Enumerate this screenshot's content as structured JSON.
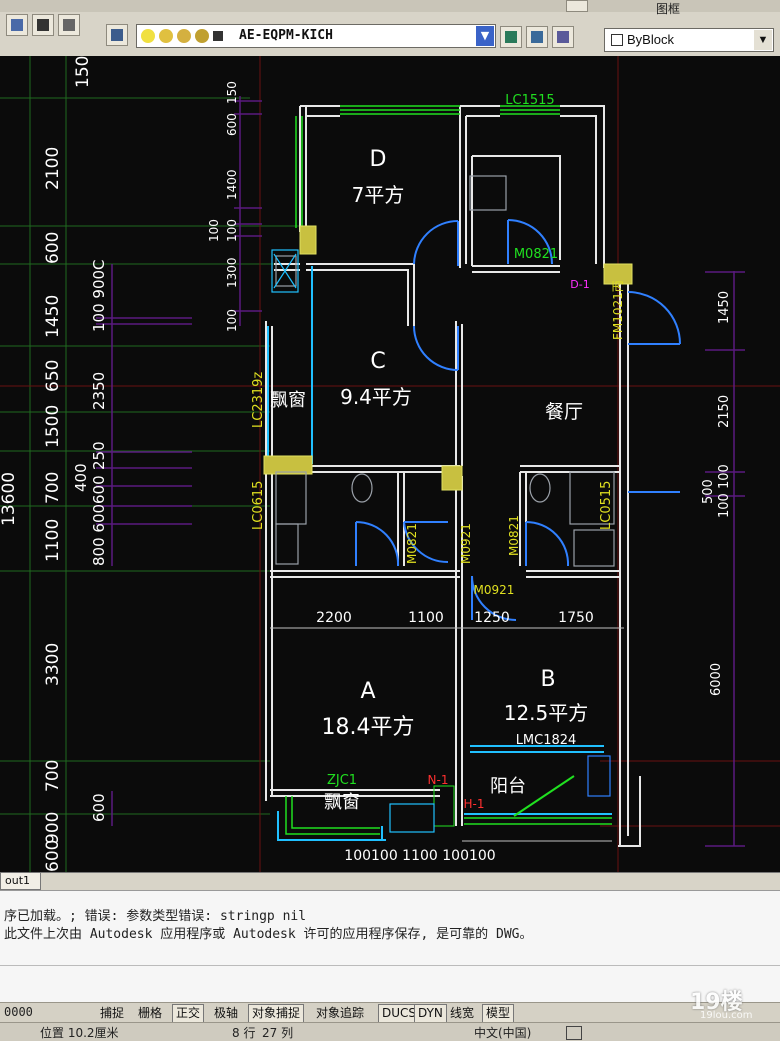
{
  "toolbar": {
    "top_label": "图框",
    "layer_name": "AE-EQPM-KICH",
    "linetype": "ByBlock"
  },
  "drawing": {
    "rooms": [
      {
        "name": "D",
        "area": "7平方"
      },
      {
        "name": "C",
        "area": "9.4平方"
      },
      {
        "name": "餐厅"
      },
      {
        "name": "A",
        "area": "18.4平方"
      },
      {
        "name": "B",
        "area": "12.5平方"
      }
    ],
    "labels": {
      "lc1515": "LC1515",
      "m0821_top": "M0821",
      "d1": "D-1",
      "fm1021": "FM1021丙",
      "piaochuang1": "飘窗",
      "lc2319z": "LC2319z",
      "lc0615": "LC0615",
      "lc0515": "LC0515",
      "m0821_a": "M0821",
      "m0921_a": "M0921",
      "m0821_b": "M0821",
      "m0921_b": "M0921",
      "n1": "N-1",
      "h1": "H-1",
      "zjc1": "ZJC1",
      "piaochuang2": "飘窗",
      "lmc1824": "LMC1824",
      "balcony": "阳台"
    },
    "dims_left_outer": [
      "150",
      "2100",
      "600",
      "1450",
      "650",
      "1500",
      "700",
      "1100",
      "3300",
      "700",
      "900",
      "600",
      "13600"
    ],
    "dims_left_mid": [
      "100 900C",
      "2350",
      "250",
      "400",
      "600",
      "800 600",
      "600"
    ],
    "dims_window": [
      "150",
      "600",
      "1400",
      "100",
      "100",
      "1300",
      "100"
    ],
    "dims_horizontal": [
      "2200",
      "1100",
      "1250",
      "1750"
    ],
    "dims_bottom": "100100 1100 100100",
    "dims_right": [
      "1450",
      "2150",
      "500",
      "100 100",
      "6000"
    ]
  },
  "tab": {
    "label": "out1"
  },
  "command": {
    "line1": "序已加载。; 错误: 参数类型错误: stringp nil",
    "line2": "此文件上次由 Autodesk 应用程序或 Autodesk 许可的应用程序保存, 是可靠的 DWG。"
  },
  "status": {
    "coords": "0000",
    "buttons": [
      "捕捉",
      "栅格",
      "正交",
      "极轴",
      "对象捕捉",
      "对象追踪",
      "DUCS",
      "DYN",
      "线宽",
      "模型"
    ]
  },
  "bottom": {
    "position": "位置 10.2厘米",
    "row": "8 行",
    "col": "27 列",
    "ime": "中文(中国)"
  },
  "watermark": {
    "text": "19楼",
    "sub": "19lou.com"
  }
}
